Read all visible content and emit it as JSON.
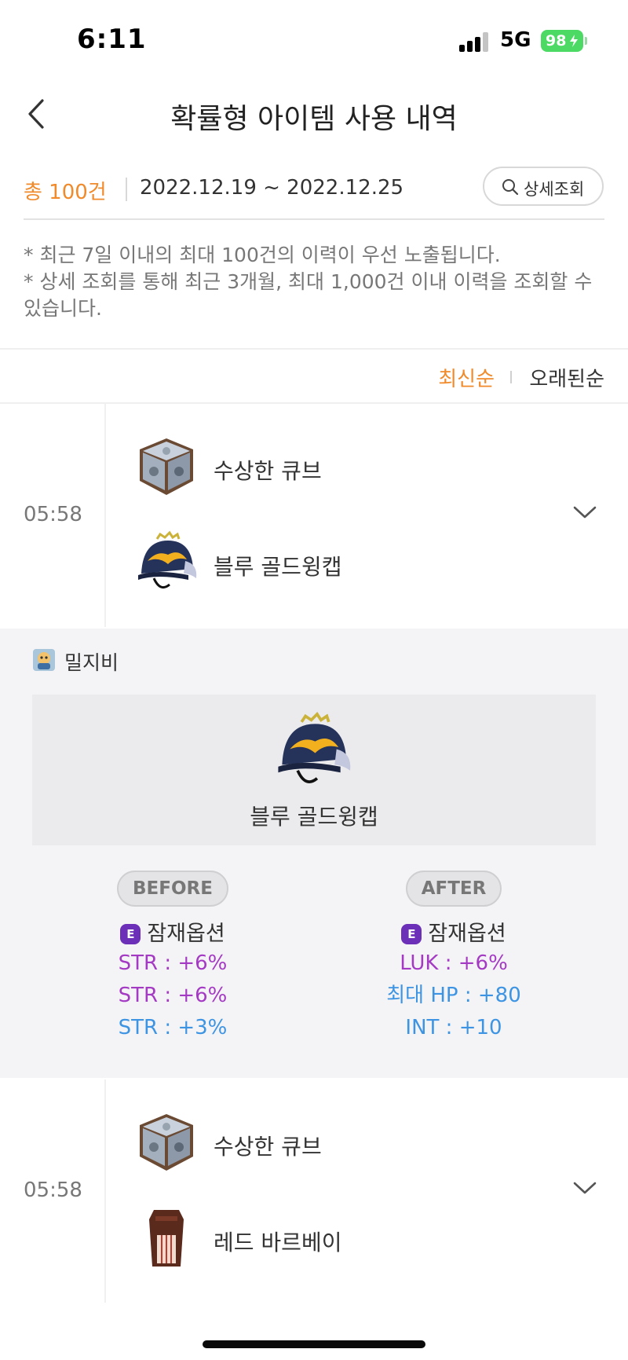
{
  "status_bar": {
    "time": "6:11",
    "network": "5G",
    "battery": "98"
  },
  "header": {
    "title": "확률형 아이템 사용 내역"
  },
  "summary": {
    "total": "총 100건",
    "date_range": "2022.12.19 ~ 2022.12.25",
    "detail_button": "상세조회"
  },
  "notice": {
    "line1": "* 최근 7일 이내의 최대 100건의 이력이 우선 노출됩니다.",
    "line2": "* 상세 조회를 통해 최근 3개월, 최대 1,000건 이내 이력을 조회할 수 있습니다."
  },
  "sort": {
    "latest": "최신순",
    "oldest": "오래된순"
  },
  "records": [
    {
      "time": "05:58",
      "cube": "수상한 큐브",
      "item": "블루 골드윙캡"
    },
    {
      "time": "05:58",
      "cube": "수상한 큐브",
      "item": "레드 바르베이"
    }
  ],
  "detail": {
    "character": "밀지비",
    "item_name": "블루 골드윙캡",
    "before": {
      "label": "BEFORE",
      "potential": "잠재옵션",
      "options": [
        "STR : +6%",
        "STR : +6%",
        "STR : +3%"
      ]
    },
    "after": {
      "label": "AFTER",
      "potential": "잠재옵션",
      "options": [
        "LUK : +6%",
        "최대 HP : +80",
        "INT : +10"
      ]
    },
    "grade_badge": "E"
  },
  "colors": {
    "accent": "#f08a2a",
    "option_purple": "#a43ac4",
    "option_blue": "#3d94e3",
    "grade_epic": "#6b2fb8"
  }
}
